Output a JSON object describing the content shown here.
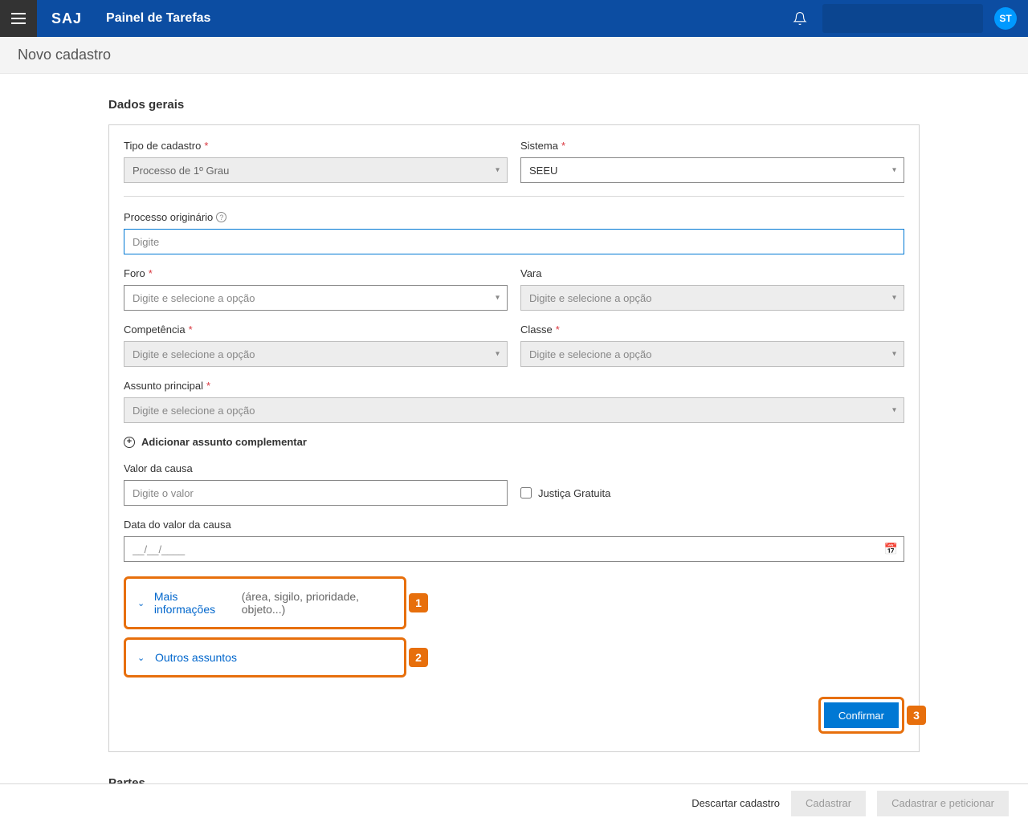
{
  "header": {
    "logo": "SAJ",
    "title": "Painel de Tarefas",
    "avatar_initials": "ST"
  },
  "subheader": {
    "title": "Novo cadastro"
  },
  "section": {
    "dados_gerais": "Dados gerais",
    "partes": "Partes"
  },
  "fields": {
    "tipo_cadastro": {
      "label": "Tipo de cadastro",
      "value": "Processo de 1º Grau"
    },
    "sistema": {
      "label": "Sistema",
      "value": "SEEU"
    },
    "processo_orig": {
      "label": "Processo originário",
      "placeholder": "Digite"
    },
    "foro": {
      "label": "Foro",
      "placeholder": "Digite e selecione a opção"
    },
    "vara": {
      "label": "Vara",
      "placeholder": "Digite e selecione a opção"
    },
    "competencia": {
      "label": "Competência",
      "placeholder": "Digite e selecione a opção"
    },
    "classe": {
      "label": "Classe",
      "placeholder": "Digite e selecione a opção"
    },
    "assunto": {
      "label": "Assunto principal",
      "placeholder": "Digite e selecione a opção"
    },
    "add_assunto": "Adicionar assunto complementar",
    "valor_causa": {
      "label": "Valor da causa",
      "placeholder": "Digite o valor"
    },
    "justica": "Justiça Gratuita",
    "data_valor": {
      "label": "Data do valor da causa",
      "placeholder": "__/__/____"
    }
  },
  "expandables": {
    "mais_info": {
      "label": "Mais informações",
      "desc": "(área, sigilo, prioridade, objeto...)"
    },
    "outros": {
      "label": "Outros assuntos"
    }
  },
  "badges": {
    "one": "1",
    "two": "2",
    "three": "3"
  },
  "buttons": {
    "confirmar": "Confirmar",
    "descartar": "Descartar cadastro",
    "cadastrar": "Cadastrar",
    "cadastrar_pet": "Cadastrar e peticionar"
  }
}
